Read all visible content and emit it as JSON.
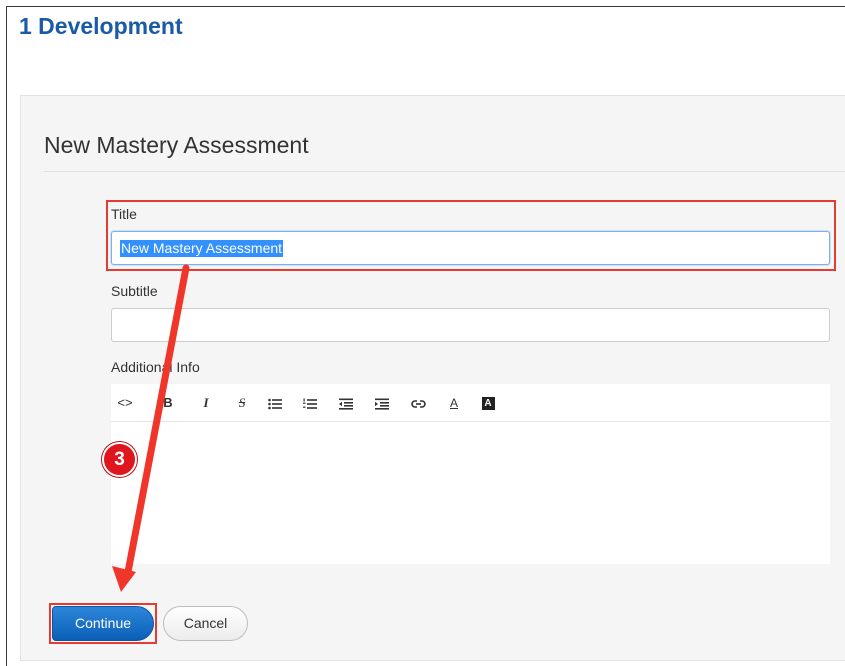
{
  "page": {
    "heading": "1 Development"
  },
  "panel": {
    "title": "New Mastery Assessment"
  },
  "form": {
    "title_label": "Title",
    "title_value": "New Mastery Assessment",
    "subtitle_label": "Subtitle",
    "subtitle_value": "",
    "additional_info_label": "Additional Info"
  },
  "editor": {
    "toolbar": [
      {
        "name": "code-view-icon",
        "glyph": "<>"
      },
      {
        "name": "bold-icon",
        "glyph": "B"
      },
      {
        "name": "italic-icon",
        "glyph": "I"
      },
      {
        "name": "strikethrough-icon",
        "glyph": "S"
      },
      {
        "name": "bulleted-list-icon",
        "glyph": ""
      },
      {
        "name": "numbered-list-icon",
        "glyph": ""
      },
      {
        "name": "outdent-icon",
        "glyph": ""
      },
      {
        "name": "indent-icon",
        "glyph": ""
      },
      {
        "name": "link-icon",
        "glyph": ""
      },
      {
        "name": "font-color-icon",
        "glyph": "A"
      },
      {
        "name": "background-color-icon",
        "glyph": "A"
      }
    ]
  },
  "actions": {
    "continue_label": "Continue",
    "cancel_label": "Cancel"
  },
  "annotation": {
    "step_number": "3",
    "highlight_color": "#e53b30",
    "arrow_color": "#f0352a"
  },
  "colors": {
    "heading": "#1a5aa6",
    "primary_button": "#0a60b8",
    "selection": "#3390ff"
  }
}
